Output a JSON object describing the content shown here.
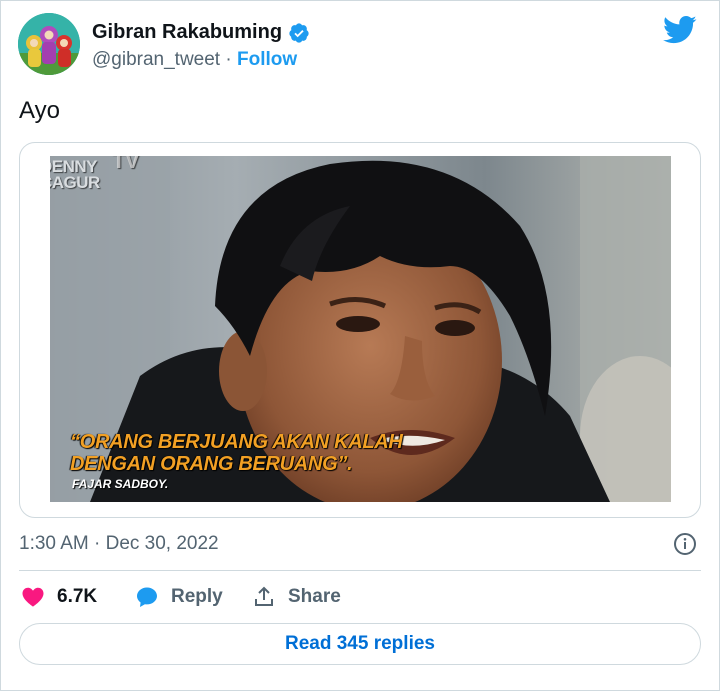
{
  "author": {
    "name": "Gibran Rakabuming",
    "handle": "@gibran_tweet",
    "separator": "·",
    "follow_label": "Follow"
  },
  "tweet": {
    "text": "Ayo",
    "timestamp": "1:30 AM · Dec 30, 2022"
  },
  "media": {
    "watermark_line1": "DENNY",
    "watermark_line2": "CAGUR",
    "watermark_tv": "TV",
    "caption_line1": "“ORANG BERJUANG AKAN KALAH",
    "caption_line2": "DENGAN ORANG BERUANG”.",
    "caption_source": "FAJAR SADBOY."
  },
  "actions": {
    "likes_count": "6.7K",
    "reply_label": "Reply",
    "share_label": "Share"
  },
  "read_replies_label": "Read 345 replies",
  "colors": {
    "accent": "#1d9bf0",
    "like": "#f91880",
    "link": "#006fd6",
    "caption": "#f2a024",
    "text_secondary": "#536471"
  },
  "icons": [
    "verified-badge-icon",
    "twitter-bird-icon",
    "info-icon",
    "heart-icon",
    "reply-bubble-icon",
    "share-icon"
  ]
}
